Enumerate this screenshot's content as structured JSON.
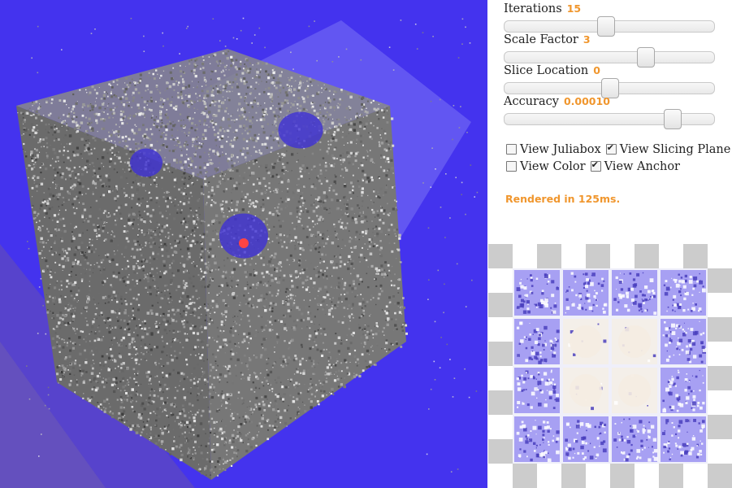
{
  "controls": {
    "sliders": [
      {
        "label": "Iterations",
        "value": "15",
        "fraction": 0.48
      },
      {
        "label": "Scale Factor",
        "value": "3",
        "fraction": 0.67
      },
      {
        "label": "Slice Location",
        "value": "0",
        "fraction": 0.5
      },
      {
        "label": "Accuracy",
        "value": "0.00010",
        "fraction": 0.8
      }
    ],
    "checkboxes": [
      {
        "label": "View Juliabox",
        "checked": false
      },
      {
        "label": "View Slicing Plane",
        "checked": true
      },
      {
        "label": "View Color",
        "checked": false
      },
      {
        "label": "View Anchor",
        "checked": true
      }
    ],
    "status": "Rendered in 125ms."
  },
  "colors": {
    "accent": "#f0962d",
    "background_blue": "#4433ee",
    "fractal_gray": "#8d8d8d",
    "slice_plane": "#7c73f5",
    "anchor_marker": "#ff4444"
  }
}
